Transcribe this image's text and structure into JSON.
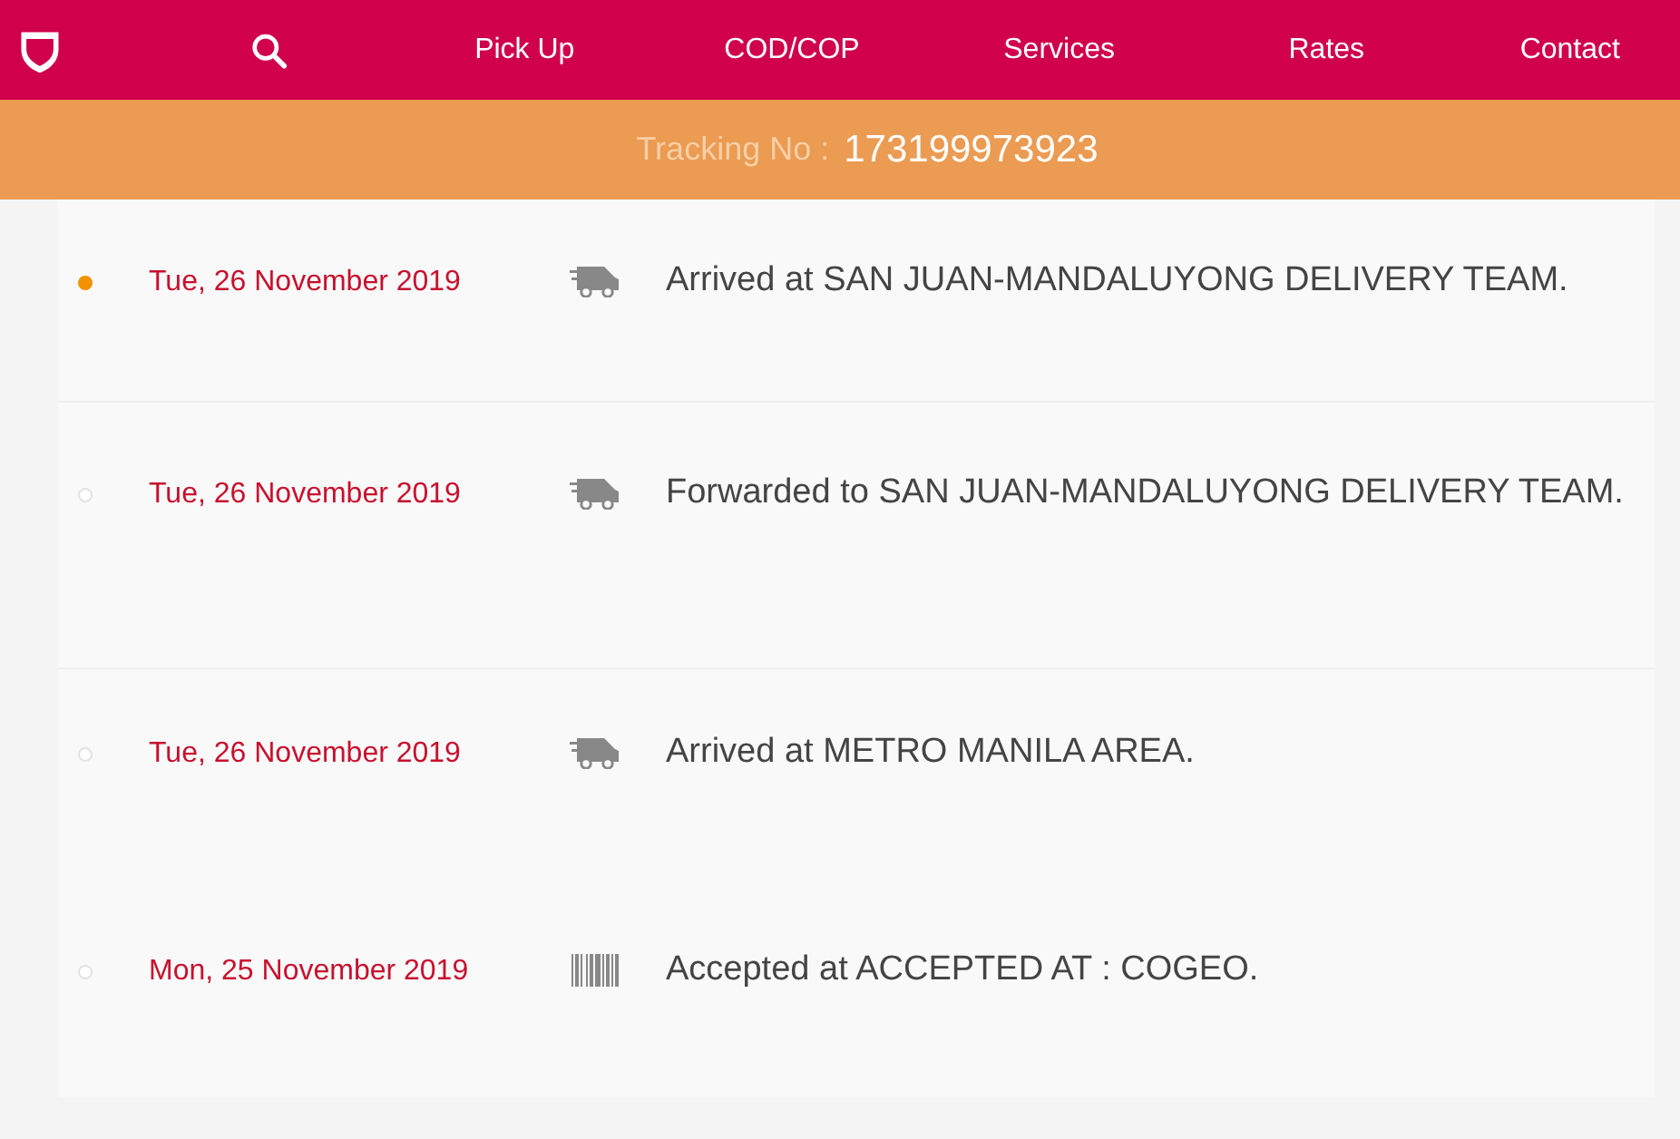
{
  "nav": {
    "items": [
      "Pick Up",
      "COD/COP",
      "Services",
      "Rates",
      "Contact"
    ]
  },
  "tracking": {
    "label": "Tracking No :",
    "number": "173199973923"
  },
  "events": [
    {
      "date": "Tue, 26 November 2019",
      "kind": "truck",
      "message": "Arrived at SAN JUAN-MANDALUYONG DELIVERY TEAM.",
      "current": true
    },
    {
      "date": "Tue, 26 November 2019",
      "kind": "truck",
      "message": "Forwarded to SAN JUAN-MANDALUYONG DELIVERY TEAM.",
      "current": false
    },
    {
      "date": "Tue, 26 November 2019",
      "kind": "truck",
      "message": "Arrived at METRO MANILA AREA.",
      "current": false
    },
    {
      "date": "Mon, 25 November 2019",
      "kind": "barcode",
      "message": "Accepted at ACCEPTED AT : COGEO.",
      "current": false
    }
  ]
}
